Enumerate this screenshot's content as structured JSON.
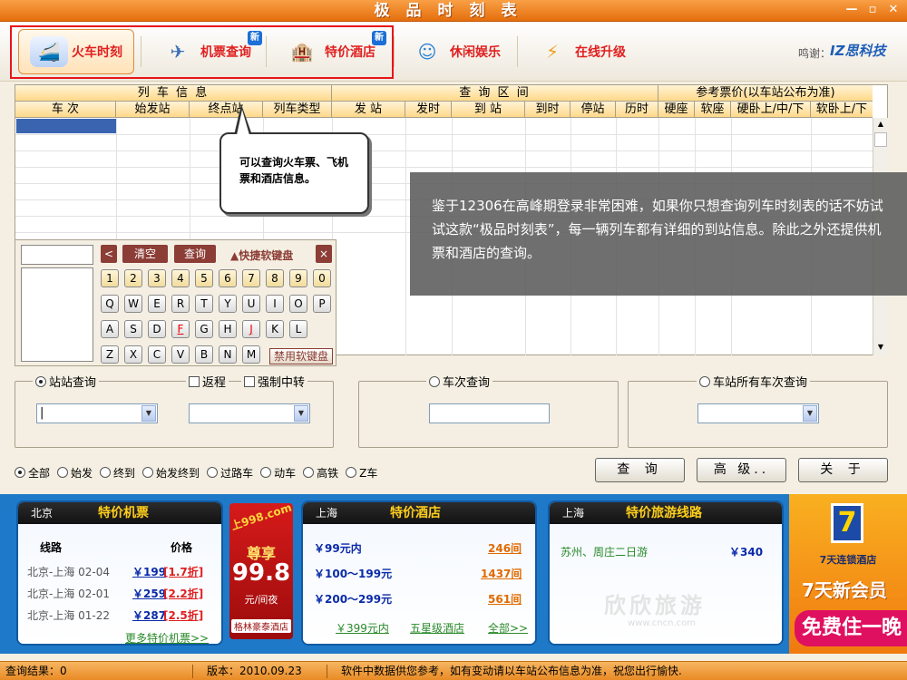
{
  "window": {
    "title": "极品时刻表",
    "min_icon": "minimize-icon",
    "max_icon": "maximize-icon",
    "close_icon": "close-icon"
  },
  "toolbar": {
    "items": [
      {
        "label": "火车时刻",
        "icon": "train-icon"
      },
      {
        "label": "机票查询",
        "icon": "airplane-icon",
        "badge": "新"
      },
      {
        "label": "特价酒店",
        "icon": "hotel-icon",
        "badge": "新"
      },
      {
        "label": "休闲娱乐",
        "icon": "smiley-icon"
      },
      {
        "label": "在线升级",
        "icon": "upgrade-icon"
      }
    ],
    "thanks": "鸣谢：",
    "thanks_brand": "IZ思科技"
  },
  "table": {
    "groups": [
      "列 车 信 息",
      "查 询 区 间",
      "参考票价(以车站公布为准)"
    ],
    "columns": [
      "车 次",
      "始发站",
      "终点站",
      "列车类型",
      "发 站",
      "发时",
      "到 站",
      "到时",
      "停站",
      "历时",
      "硬座",
      "软座",
      "硬卧上/中/下",
      "软卧上/下"
    ]
  },
  "callout": {
    "text": "可以查询火车票、飞机票和酒店信息。"
  },
  "note": {
    "text": "鉴于12306在高峰期登录非常困难，如果你只想查询列车时刻表的话不妨试试这款“极品时刻表”，每一辆列车都有详细的到站信息。除此之外还提供机票和酒店的查询。"
  },
  "keyboard": {
    "back": "<",
    "clear": "清空",
    "query": "查询",
    "title": "▲快捷软键盘",
    "close": "×",
    "rows": [
      [
        "1",
        "2",
        "3",
        "4",
        "5",
        "6",
        "7",
        "8",
        "9",
        "0"
      ],
      [
        "Q",
        "W",
        "E",
        "R",
        "T",
        "Y",
        "U",
        "I",
        "O",
        "P"
      ],
      [
        "A",
        "S",
        "D",
        "F",
        "G",
        "H",
        "J",
        "K",
        "L"
      ],
      [
        "Z",
        "X",
        "C",
        "V",
        "B",
        "N",
        "M"
      ]
    ],
    "highlight_keys": [
      "F",
      "J"
    ],
    "disable": "禁用软键盘"
  },
  "search": {
    "station": {
      "label": "站站查询",
      "selected": true
    },
    "return_trip": {
      "label": "返程",
      "checked": false
    },
    "force_transfer": {
      "label": "强制中转",
      "checked": false
    },
    "train_no": {
      "label": "车次查询",
      "selected": false
    },
    "all_trains": {
      "label": "车站所有车次查询",
      "selected": false
    },
    "from_value": "|",
    "to_value": "",
    "train_value": "",
    "station_value": ""
  },
  "filters": {
    "options": [
      "全部",
      "始发",
      "终到",
      "始发终到",
      "过路车",
      "动车",
      "高铁",
      "Z车"
    ],
    "selected": "全部"
  },
  "actions": {
    "query": "查 询",
    "advanced": "高 级..",
    "about": "关 于"
  },
  "ads": {
    "flights": {
      "city": "北京",
      "title": "特价机票",
      "col_route": "线路",
      "col_price": "价格",
      "rows": [
        {
          "route": "北京-上海 02-04",
          "price": "￥199",
          "disc": "[1.7折]"
        },
        {
          "route": "北京-上海 02-01",
          "price": "￥259",
          "disc": "[2.2折]"
        },
        {
          "route": "北京-上海 01-22",
          "price": "￥287",
          "disc": "[2.5折]"
        }
      ],
      "more": "更多特价机票>>"
    },
    "promo": {
      "tag": "上998.com",
      "line1": "尊享",
      "line2": "99.8",
      "unit": "元/间夜",
      "name": "格林豪泰酒店"
    },
    "hotels": {
      "city": "上海",
      "title": "特价酒店",
      "rows": [
        {
          "range": "￥99元内",
          "count": "246间"
        },
        {
          "range": "￥100～199元",
          "count": "1437间"
        },
        {
          "range": "￥200～299元",
          "count": "561间"
        }
      ],
      "links": [
        "￥399元内",
        "五星级酒店",
        "全部>>"
      ]
    },
    "tours": {
      "city": "上海",
      "title": "特价旅游线路",
      "rows": [
        {
          "name": "苏州、周庄二日游",
          "price": "￥340"
        }
      ],
      "watermark": "欣欣旅游",
      "watermark_url": "www.cncn.com"
    },
    "seven": {
      "logo": "7",
      "name": "7天连锁酒店",
      "slogan": "7天新会员",
      "free": "免费住一晚"
    }
  },
  "status": {
    "result": "查询结果：0",
    "version": "版本：2010.09.23",
    "notice": "软件中数据供您参考，如有变动请以车站公布信息为准，祝您出行愉快."
  },
  "colors": {
    "accent": "#e56e0c",
    "highlight_box": "#e8141a",
    "ad_blue": "#1f79c9",
    "selection": "#3a64b0"
  }
}
